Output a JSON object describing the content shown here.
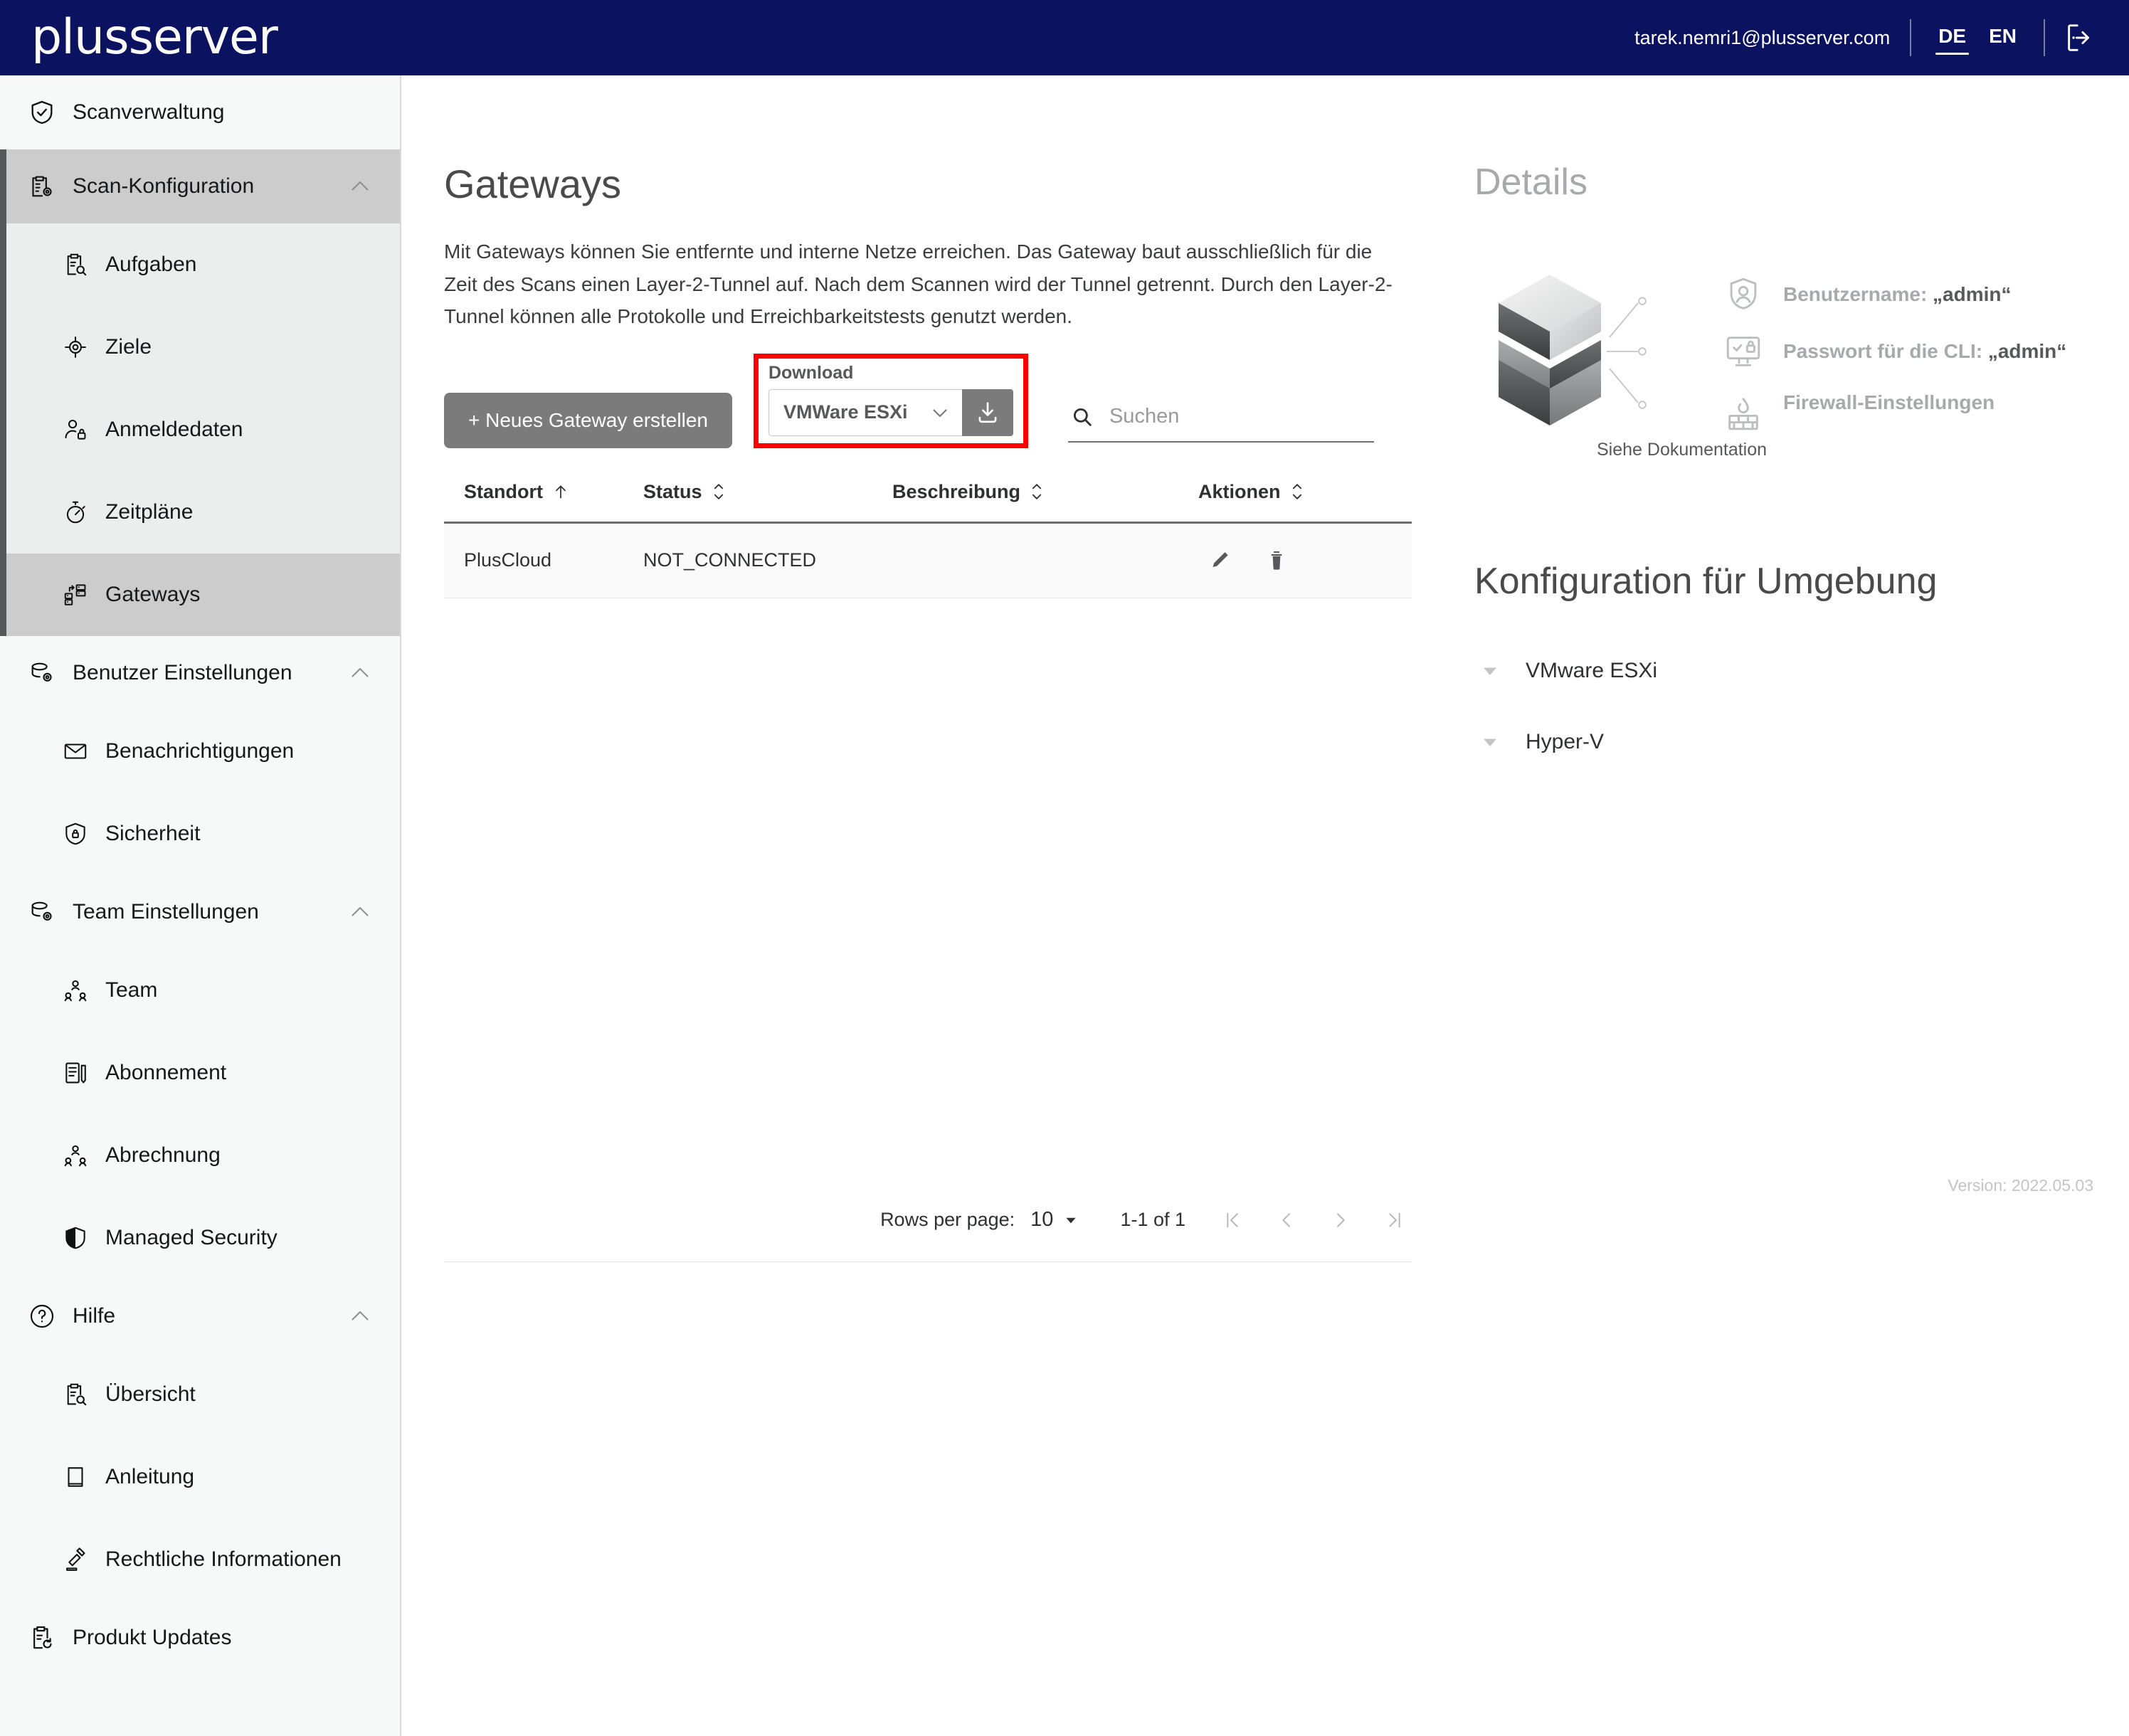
{
  "header": {
    "logo_text": "plusserver",
    "user_email": "tarek.nemri1@plusserver.com",
    "lang_de": "DE",
    "lang_en": "EN",
    "active_lang": "DE",
    "logout_icon": "logout-icon",
    "brand_color": "#0b1360"
  },
  "sidebar": {
    "groups": [
      {
        "label": "Scanverwaltung",
        "icon": "shield-check-icon",
        "type": "solo",
        "expanded": false,
        "children": []
      },
      {
        "label": "Scan-Konfiguration",
        "icon": "clipboard-gear-icon",
        "type": "group",
        "expanded": true,
        "children": [
          {
            "label": "Aufgaben",
            "icon": "clipboard-search-icon",
            "active": false
          },
          {
            "label": "Ziele",
            "icon": "target-icon",
            "active": false
          },
          {
            "label": "Anmeldedaten",
            "icon": "user-lock-icon",
            "active": false
          },
          {
            "label": "Zeitpläne",
            "icon": "stopwatch-icon",
            "active": false
          },
          {
            "label": "Gateways",
            "icon": "servers-exchange-icon",
            "active": true
          }
        ]
      },
      {
        "label": "Benutzer Einstellungen",
        "icon": "database-gear-icon",
        "type": "group",
        "expanded": false,
        "children": [
          {
            "label": "Benachrichtigungen",
            "icon": "envelope-icon",
            "active": false
          },
          {
            "label": "Sicherheit",
            "icon": "shield-lock-icon",
            "active": false
          }
        ]
      },
      {
        "label": "Team Einstellungen",
        "icon": "database-gear-icon",
        "type": "group",
        "expanded": false,
        "children": [
          {
            "label": "Team",
            "icon": "people-icon",
            "active": false
          },
          {
            "label": "Abonnement",
            "icon": "document-pen-icon",
            "active": false
          },
          {
            "label": "Abrechnung",
            "icon": "people-icon",
            "active": false
          },
          {
            "label": "Managed Security",
            "icon": "shield-filled-icon",
            "active": false
          }
        ]
      },
      {
        "label": "Hilfe",
        "icon": "question-circle-icon",
        "type": "group",
        "expanded": false,
        "children": [
          {
            "label": "Übersicht",
            "icon": "clipboard-search-icon",
            "active": false
          },
          {
            "label": "Anleitung",
            "icon": "book-icon",
            "active": false
          },
          {
            "label": "Rechtliche Informationen",
            "icon": "gavel-icon",
            "active": false
          }
        ]
      },
      {
        "label": "Produkt Updates",
        "icon": "clipboard-refresh-icon",
        "type": "solo",
        "expanded": false,
        "children": []
      }
    ]
  },
  "main": {
    "title": "Gateways",
    "description": "Mit Gateways können Sie entfernte und interne Netze erreichen. Das Gateway baut ausschließlich für die Zeit des Scans einen Layer-2-Tunnel auf. Nach dem Scannen wird der Tunnel getrennt. Durch den Layer-2-Tunnel können alle Protokolle und Erreichbarkeitstests genutzt werden.",
    "create_button": "+ Neues Gateway erstellen",
    "download": {
      "label": "Download",
      "selected": "VMWare ESXi",
      "options": [
        "VMWare ESXi",
        "Hyper-V"
      ],
      "dropdown_icon": "chevron-down-icon",
      "download_icon": "download-icon",
      "highlight_color": "#ff0000"
    },
    "search": {
      "placeholder": "Suchen",
      "value": "",
      "icon": "search-icon"
    },
    "table": {
      "columns": [
        {
          "label": "Standort",
          "sort": "asc"
        },
        {
          "label": "Status",
          "sort": "none"
        },
        {
          "label": "Beschreibung",
          "sort": "none"
        },
        {
          "label": "Aktionen",
          "sort": "none"
        }
      ],
      "rows": [
        {
          "standort": "PlusCloud",
          "status": "NOT_CONNECTED",
          "beschreibung": "",
          "actions": [
            {
              "icon": "edit-pencil-icon",
              "name": "edit-gateway-button"
            },
            {
              "icon": "trash-icon",
              "name": "delete-gateway-button"
            }
          ]
        }
      ]
    },
    "pagination": {
      "rows_per_page_label": "Rows per page:",
      "rows_per_page_value": "10",
      "range": "1-1 of 1",
      "first_icon": "first-page-icon",
      "prev_icon": "prev-page-icon",
      "next_icon": "next-page-icon",
      "last_icon": "last-page-icon"
    }
  },
  "right": {
    "details_title": "Details",
    "graphic": "stacked-cubes-illustration",
    "items": [
      {
        "icon": "shield-user-icon",
        "prefix": "Benutzername: ",
        "value": "„admin“"
      },
      {
        "icon": "monitor-lock-icon",
        "prefix": "Passwort für die CLI: ",
        "value": "„admin“"
      },
      {
        "icon": "firewall-icon",
        "prefix": "Firewall-Einstellungen",
        "value": ""
      }
    ],
    "firewall_sub": "Siehe Dokumentation",
    "konfig_title": "Konfiguration für Umgebung",
    "konfig_items": [
      {
        "label": "VMware ESXi",
        "icon": "triangle-down-icon"
      },
      {
        "label": "Hyper-V",
        "icon": "triangle-down-icon"
      }
    ],
    "version": "Version: 2022.05.03"
  }
}
